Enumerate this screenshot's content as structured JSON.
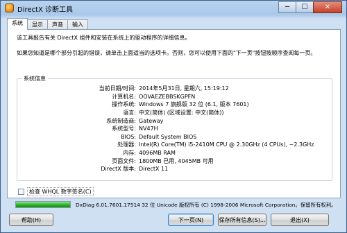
{
  "window": {
    "title": "DirectX 诊断工具",
    "min_label": "─",
    "max_label": "☐",
    "close_label": "✕"
  },
  "tabs": [
    {
      "label": "系统"
    },
    {
      "label": "显示"
    },
    {
      "label": "声音"
    },
    {
      "label": "输入"
    }
  ],
  "intro": {
    "line1": "该工具报告有关 DirectX 组件和安装在系统上的驱动程序的详细信息。",
    "line2": "如果您知道是哪个部分引起的错误，请单击上面适当的选项卡。否则，您可以使用下面的\"下一页\"按钮按顺序查阅每一页。"
  },
  "system_info": {
    "group_label": "系统信息",
    "rows": [
      {
        "label": "当前日期/时间:",
        "value": "2014年5月31日, 星期六, 15:19:12"
      },
      {
        "label": "计算机名:",
        "value": "OOVAEZEBBSKGPFN"
      },
      {
        "label": "操作系统:",
        "value": "Windows 7 旗舰版 32 位 (6.1, 版本 7601)"
      },
      {
        "label": "语言:",
        "value": "中文(简体) (区域设置: 中文(简体))"
      },
      {
        "label": "系统制造商:",
        "value": "Gateway"
      },
      {
        "label": "系统型号:",
        "value": "NV47H"
      },
      {
        "label": "BIOS:",
        "value": "Default System BIOS"
      },
      {
        "label": "处理器:",
        "value": "Intel(R) Core(TM) i5-2410M CPU @ 2.30GHz (4 CPUs), ~2.3GHz"
      },
      {
        "label": "内存:",
        "value": "4096MB RAM"
      },
      {
        "label": "页面文件:",
        "value": "1800MB 已用, 4045MB 可用"
      },
      {
        "label": "DirectX 版本:",
        "value": "DirectX 11"
      }
    ]
  },
  "whql": {
    "label": "检查 WHQL 数字签名(C)",
    "checked": false
  },
  "status": {
    "progress": 1.0,
    "progress_color": "#22b022",
    "text": "DxDiag 6.01.7601.17514 32 位 Unicode 版权所有 (C) 1998-2006 Microsoft Corporation。保留所有权利。"
  },
  "buttons": {
    "help": "帮助(H)",
    "next": "下一页(N)",
    "save": "保存所有信息(S)...",
    "exit": "退出(X)"
  }
}
